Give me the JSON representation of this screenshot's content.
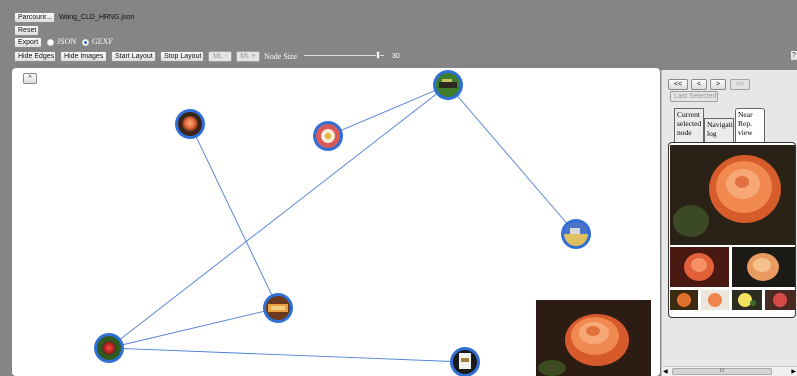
{
  "toolbar": {
    "browse_label": "Parcourir...",
    "file_name": "Wang_CLD_HRNG.json",
    "reset_label": "Reset",
    "export_label": "Export",
    "format_options": [
      "JSON",
      "GEXF"
    ],
    "format_selected": "GEXF",
    "hide_edges_label": "Hide Edges",
    "hide_images_label": "Hide Images",
    "start_layout_label": "Start Layout",
    "stop_layout_label": "Stop Layout",
    "ml_minus_label": "ML -",
    "ml_plus_label": "ML +",
    "node_size_label": "Node Size",
    "node_size_value": "30",
    "node_size_fraction": 0.95,
    "right_corner_label": "?"
  },
  "graph": {
    "collapse_label": "^",
    "colors": {
      "node_ring": "#2f6fd6",
      "edge": "#4d7fd1",
      "background": "#ffffff"
    }
  },
  "right_panel": {
    "nav_first": "<<",
    "nav_prev": "<",
    "nav_next": ">",
    "nav_last": ">>",
    "last_selected_label": "Last Selected",
    "tabs": [
      {
        "label": "Current selected node"
      },
      {
        "label": "Navigation log"
      },
      {
        "label": "Near Rep. view"
      }
    ],
    "scroll_label": "III"
  }
}
